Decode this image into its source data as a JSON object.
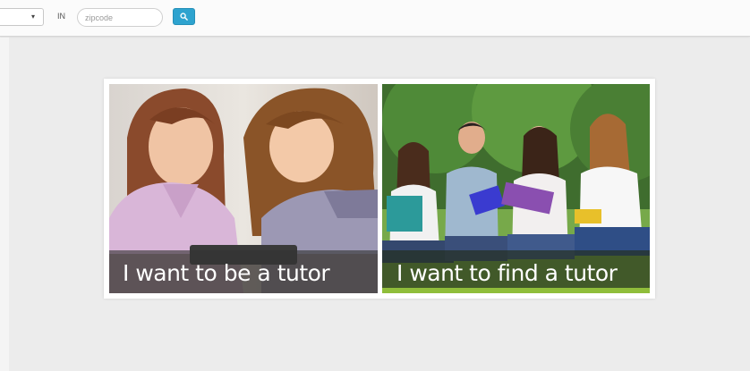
{
  "search": {
    "category_value": "",
    "in_label": "IN",
    "zip_placeholder": "zipcode",
    "zip_value": ""
  },
  "cards": [
    {
      "caption": "I want to be a tutor"
    },
    {
      "caption": "I want to find a tutor"
    }
  ],
  "colors": {
    "page_background": "#ececec",
    "search_button": "#2ea3cf",
    "topbar": "#fbfbfb"
  },
  "icons": {
    "search_button_icon": "search-icon",
    "select_caret": "caret-down-icon"
  }
}
